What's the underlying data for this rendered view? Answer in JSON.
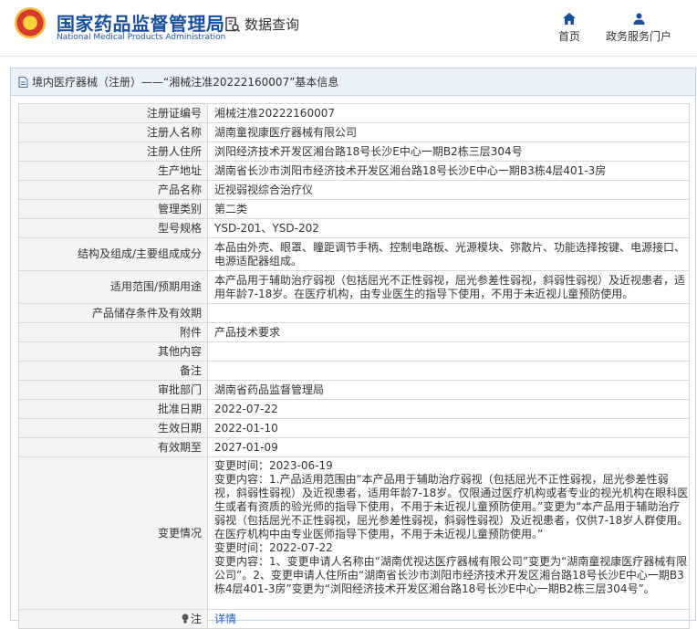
{
  "header": {
    "site_name_cn": "国家药品监督管理局",
    "site_name_en": "National Medical Products Administration",
    "db_query_label": "数据查询",
    "nav_home": "首页",
    "nav_portal": "政务服务门户"
  },
  "card": {
    "title": "境内医疗器械（注册）——“湘械注准20222160007”基本信息"
  },
  "rows": [
    {
      "label": "注册证编号",
      "value": "湘械注准20222160007"
    },
    {
      "label": "注册人名称",
      "value": "湖南童视康医疗器械有限公司"
    },
    {
      "label": "注册人住所",
      "value": "浏阳经济技术开发区湘台路18号长沙E中心一期B2栋三层304号"
    },
    {
      "label": "生产地址",
      "value": "湖南省长沙市浏阳市经济技术开发区湘台路18号长沙E中心一期B3栋4层401-3房"
    },
    {
      "label": "产品名称",
      "value": "近视弱视综合治疗仪"
    },
    {
      "label": "管理类别",
      "value": "第二类"
    },
    {
      "label": "型号规格",
      "value": "YSD-201、YSD-202"
    },
    {
      "label": "结构及组成/主要组成成分",
      "value": "本品由外壳、眼罩、瞳距调节手柄、控制电路板、光源模块、弥散片、功能选择按键、电源接口、电源适配器组成。"
    },
    {
      "label": "适用范围/预期用途",
      "value": "本产品用于辅助治疗弱视（包括屈光不正性弱视，屈光参差性弱视，斜弱性弱视）及近视患者，适用年龄7-18岁。在医疗机构，由专业医生的指导下使用，不用于未近视儿童预防使用。"
    },
    {
      "label": "产品储存条件及有效期",
      "value": ""
    },
    {
      "label": "附件",
      "value": "产品技术要求"
    },
    {
      "label": "其他内容",
      "value": ""
    },
    {
      "label": "备注",
      "value": ""
    },
    {
      "label": "审批部门",
      "value": "湖南省药品监督管理局"
    },
    {
      "label": "批准日期",
      "value": "2022-07-22"
    },
    {
      "label": "生效日期",
      "value": "2022-01-10"
    },
    {
      "label": "有效期至",
      "value": "2027-01-09"
    },
    {
      "label": "变更情况",
      "value": "变更时间：2023-06-19\n变更内容：1.产品适用范围由“本产品用于辅助治疗弱视（包括屈光不正性弱视，屈光参差性弱视，斜弱性弱视）及近视患者，适用年龄7-18岁。仅限通过医疗机构或者专业的视光机构在眼科医生或者有资质的验光师的指导下使用，不用于未近视儿童预防使用。”变更为“本产品用于辅助治疗弱视（包括屈光不正性弱视，屈光参差性弱视，斜弱性弱视）及近视患者，仅供7-18岁人群使用。在医疗机构中由专业医师指导下使用，不用于未近视儿童预防使用。”\n变更时间：2022-07-22\n变更内容：1、变更申请人名称由“湖南优视达医疗器械有限公司”变更为“湖南童视康医疗器械有限公司”。2、变更申请人住所由“湖南省长沙市浏阳市经济技术开发区湘台路18号长沙E中心一期B3栋4层401-3房”变更为“浏阳经济技术开发区湘台路18号长沙E中心一期B2栋三层304号”。"
    },
    {
      "label": "注",
      "value": "详情"
    }
  ]
}
